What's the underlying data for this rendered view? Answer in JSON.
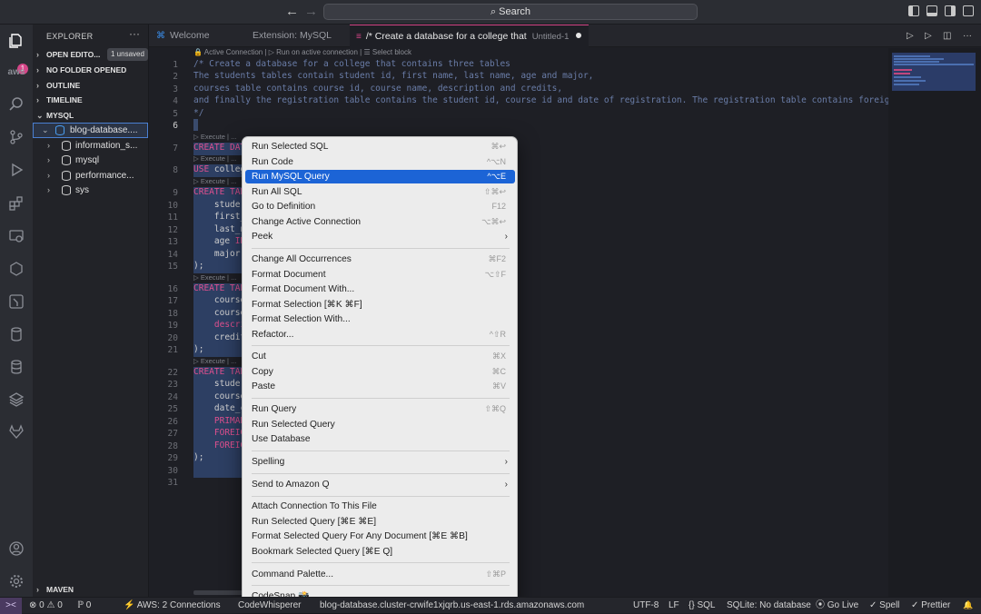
{
  "titlebar": {
    "back": "←",
    "forward": "→",
    "search": "Search"
  },
  "activity": {
    "badge": "1",
    "icons": [
      "explorer-icon",
      "aws-icon",
      "search-icon",
      "source-control-icon",
      "run-debug-icon",
      "extensions-icon",
      "remote-explorer-icon",
      "database-icon",
      "testing-icon",
      "mysql-icon",
      "database-stack-icon",
      "layers-icon",
      "gitlab-icon",
      "account-icon",
      "settings-gear-icon"
    ]
  },
  "sidebar": {
    "title": "EXPLORER",
    "more": "···",
    "open_editors": "OPEN EDITO...",
    "unsaved": "1 unsaved",
    "no_folder": "NO FOLDER OPENED",
    "outline": "OUTLINE",
    "timeline": "TIMELINE",
    "mysql": "MYSQL",
    "connection": "blog-database....",
    "databases": [
      "information_s...",
      "mysql",
      "performance...",
      "sys"
    ],
    "maven": "MAVEN"
  },
  "tabs": [
    {
      "label": "Welcome",
      "icon": "vscode-icon"
    },
    {
      "label": "Extension: MySQL",
      "icon": ""
    },
    {
      "label": "/* Create a database for a college that",
      "sub": "Untitled-1",
      "icon": "sql-file-icon"
    }
  ],
  "codelens_top": "🔒 Active Connection | ▷ Run on active connection | ☰ Select block",
  "line_numbers": [
    "1",
    "2",
    "3",
    "4",
    "5",
    "6",
    "7",
    "8",
    "9",
    "10",
    "11",
    "12",
    "13",
    "14",
    "15",
    "16",
    "17",
    "18",
    "19",
    "20",
    "21",
    "22",
    "23",
    "24",
    "25",
    "26",
    "27",
    "28",
    "29",
    "30",
    "31"
  ],
  "code": {
    "l1": "/* Create a database for a college that contains three tables",
    "l2": "The students tables contain student id, first name, last name, age and major,",
    "l3": "courses table contains course id, course name, description and credits,",
    "l4": "and finally the registration table contains the student id, course id and date of registration. The registration table contains foreign keys o",
    "l5": "*/",
    "l7": "CREATE DAT",
    "l8a": "USE",
    "l8b": " colleg",
    "l9": "CREATE TAB",
    "l10": "    studer",
    "l11": "    first_",
    "l12": "    last_n",
    "l13a": "    age ",
    "l13b": "IN",
    "l14": "    major ",
    "l15": ");",
    "l16": "CREATE TAB",
    "l17": "    course",
    "l18": "    course",
    "l19": "    descri",
    "l20": "    credit",
    "l21": ");",
    "l22": "CREATE TAB",
    "l23": "    studer",
    "l24": "    course",
    "l25": "    date_c",
    "l26": "    PRIMAR",
    "l27": "    FOREIG",
    "l28": "    FOREIG",
    "l29": ");",
    "exec": "▷ Execute | ..."
  },
  "context_menu": {
    "g1": [
      {
        "label": "Run Selected SQL",
        "sc": "⌘↩"
      },
      {
        "label": "Run Code",
        "sc": "^⌥N"
      },
      {
        "label": "Run MySQL Query",
        "sc": "^⌥E",
        "highlighted": true
      },
      {
        "label": "Run All SQL",
        "sc": "⇧⌘↩"
      },
      {
        "label": "Go to Definition",
        "sc": "F12"
      },
      {
        "label": "Change Active Connection",
        "sc": "⌥⌘↩"
      },
      {
        "label": "Peek",
        "sc": "",
        "submenu": true
      }
    ],
    "g2": [
      {
        "label": "Change All Occurrences",
        "sc": "⌘F2"
      },
      {
        "label": "Format Document",
        "sc": "⌥⇧F"
      },
      {
        "label": "Format Document With...",
        "sc": ""
      },
      {
        "label": "Format Selection [⌘K ⌘F]",
        "sc": ""
      },
      {
        "label": "Format Selection With...",
        "sc": ""
      },
      {
        "label": "Refactor...",
        "sc": "^⇧R"
      }
    ],
    "g3": [
      {
        "label": "Cut",
        "sc": "⌘X"
      },
      {
        "label": "Copy",
        "sc": "⌘C"
      },
      {
        "label": "Paste",
        "sc": "⌘V"
      }
    ],
    "g4": [
      {
        "label": "Run Query",
        "sc": "⇧⌘Q"
      },
      {
        "label": "Run Selected Query",
        "sc": ""
      },
      {
        "label": "Use Database",
        "sc": ""
      }
    ],
    "g5": [
      {
        "label": "Spelling",
        "sc": "",
        "submenu": true
      }
    ],
    "g6": [
      {
        "label": "Send to Amazon Q",
        "sc": "",
        "submenu": true
      }
    ],
    "g7": [
      {
        "label": "Attach Connection To This File",
        "sc": ""
      },
      {
        "label": "Run Selected Query [⌘E ⌘E]",
        "sc": ""
      },
      {
        "label": "Format Selected Query For Any Document [⌘E ⌘B]",
        "sc": ""
      },
      {
        "label": "Bookmark Selected Query [⌘E Q]",
        "sc": ""
      }
    ],
    "g8": [
      {
        "label": "Command Palette...",
        "sc": "⇧⌘P"
      }
    ],
    "g9": [
      {
        "label": "CodeSnap 📸",
        "sc": ""
      }
    ]
  },
  "statusbar": {
    "remote": "><",
    "problems": "⊗ 0 ⚠ 0",
    "ports": "ℙ 0",
    "aws": "AWS: 2 Connections",
    "codewhisperer": "CodeWhisperer",
    "db": "blog-database.cluster-crwife1xjqrb.us-east-1.rds.amazonaws.com",
    "encoding": "UTF-8",
    "eol": "LF",
    "lang": "{} SQL",
    "sqlite": "SQLite: No database",
    "golive": "Go Live",
    "spell": "✓ Spell",
    "prettier": "✓ Prettier",
    "bell": "🔔"
  }
}
